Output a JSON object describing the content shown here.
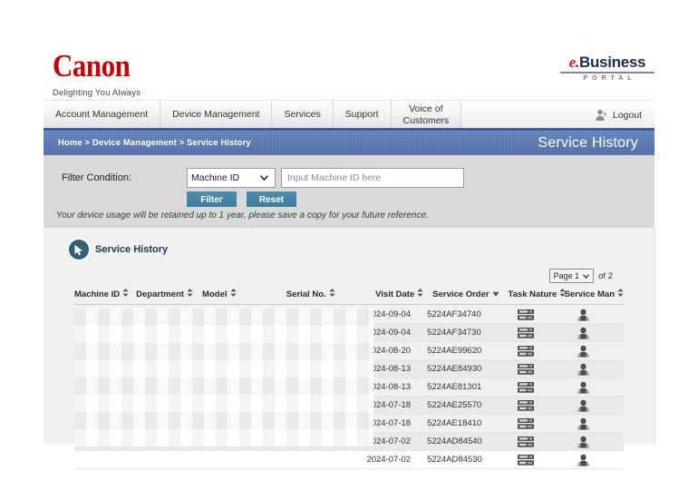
{
  "brand": {
    "canon_wordmark": "Canon",
    "canon_tagline": "Delighting You Always",
    "portal_e": "e.",
    "portal_business": "Business",
    "portal_sub": "PORTAL",
    "canon_red": "#cc0000",
    "portal_navy": "#1b2d4f"
  },
  "nav": {
    "items": [
      {
        "label": "Account Management",
        "name": "nav-account-management"
      },
      {
        "label": "Device Management",
        "name": "nav-device-management"
      },
      {
        "label": "Services",
        "name": "nav-services"
      },
      {
        "label": "Support",
        "name": "nav-support"
      },
      {
        "label": "Voice of\nCustomers",
        "name": "nav-voice-of-customers"
      }
    ],
    "logout_label": "Logout",
    "accent": "#3b5c9e"
  },
  "titlebar": {
    "breadcrumb": "Home > Device Management > Service History",
    "page_title": "Service History",
    "background": "#4a6aa9"
  },
  "filter": {
    "label": "Filter Condition:",
    "select_value": "Machine ID",
    "input_value": "",
    "input_placeholder": "Input Machine ID here",
    "filter_button": "Filter",
    "reset_button": "Reset",
    "note": "Your device usage will be retained up to 1 year, please save a copy for your future reference.",
    "button_color": "#3d7c9e",
    "panel_color": "#d9d9d9"
  },
  "section": {
    "title": "Service History",
    "icon": "cursor-pointer-icon",
    "icon_color": "#2e6078"
  },
  "pager": {
    "page_value": "Page 1",
    "of_label": "of 2"
  },
  "table": {
    "columns": [
      {
        "label": "Machine ID",
        "sort": "both",
        "name": "col-machine-id"
      },
      {
        "label": "Department",
        "sort": "both",
        "name": "col-department"
      },
      {
        "label": "Model",
        "sort": "both",
        "name": "col-model"
      },
      {
        "label": "Serial No.",
        "sort": "both",
        "name": "col-serial-no"
      },
      {
        "label": "Visit Date",
        "sort": "both",
        "name": "col-visit-date"
      },
      {
        "label": "Service Order",
        "sort": "desc",
        "name": "col-service-order"
      },
      {
        "label": "Task Nature",
        "sort": "both",
        "name": "col-task-nature"
      },
      {
        "label": "Service Man",
        "sort": "both",
        "name": "col-service-man"
      }
    ],
    "rows": [
      {
        "machine_id": "",
        "department": "",
        "model": "",
        "serial_no": "",
        "visit_date": "2024-09-04",
        "service_order": "5224AF34740",
        "task_nature": "printer-icon",
        "service_man": "person-icon"
      },
      {
        "machine_id": "",
        "department": "",
        "model": "",
        "serial_no": "",
        "visit_date": "2024-09-04",
        "service_order": "5224AF34730",
        "task_nature": "printer-icon",
        "service_man": "person-icon"
      },
      {
        "machine_id": "",
        "department": "",
        "model": "",
        "serial_no": "",
        "visit_date": "2024-08-20",
        "service_order": "5224AE99620",
        "task_nature": "printer-icon",
        "service_man": "person-icon"
      },
      {
        "machine_id": "",
        "department": "",
        "model": "",
        "serial_no": "",
        "visit_date": "2024-08-13",
        "service_order": "5224AE84930",
        "task_nature": "printer-icon",
        "service_man": "person-icon"
      },
      {
        "machine_id": "",
        "department": "",
        "model": "",
        "serial_no": "",
        "visit_date": "2024-08-13",
        "service_order": "5224AE81301",
        "task_nature": "printer-icon",
        "service_man": "person-icon"
      },
      {
        "machine_id": "",
        "department": "",
        "model": "",
        "serial_no": "",
        "visit_date": "2024-07-18",
        "service_order": "5224AE25570",
        "task_nature": "printer-icon",
        "service_man": "person-icon"
      },
      {
        "machine_id": "",
        "department": "",
        "model": "",
        "serial_no": "",
        "visit_date": "2024-07-18",
        "service_order": "5224AE18410",
        "task_nature": "printer-icon",
        "service_man": "person-icon"
      },
      {
        "machine_id": "",
        "department": "",
        "model": "",
        "serial_no": "",
        "visit_date": "2024-07-02",
        "service_order": "5224AD84540",
        "task_nature": "printer-icon",
        "service_man": "person-icon"
      },
      {
        "machine_id": "",
        "department": "",
        "model": "",
        "serial_no": "",
        "visit_date": "2024-07-02",
        "service_order": "5224AD84530",
        "task_nature": "printer-icon",
        "service_man": "person-icon"
      }
    ]
  }
}
